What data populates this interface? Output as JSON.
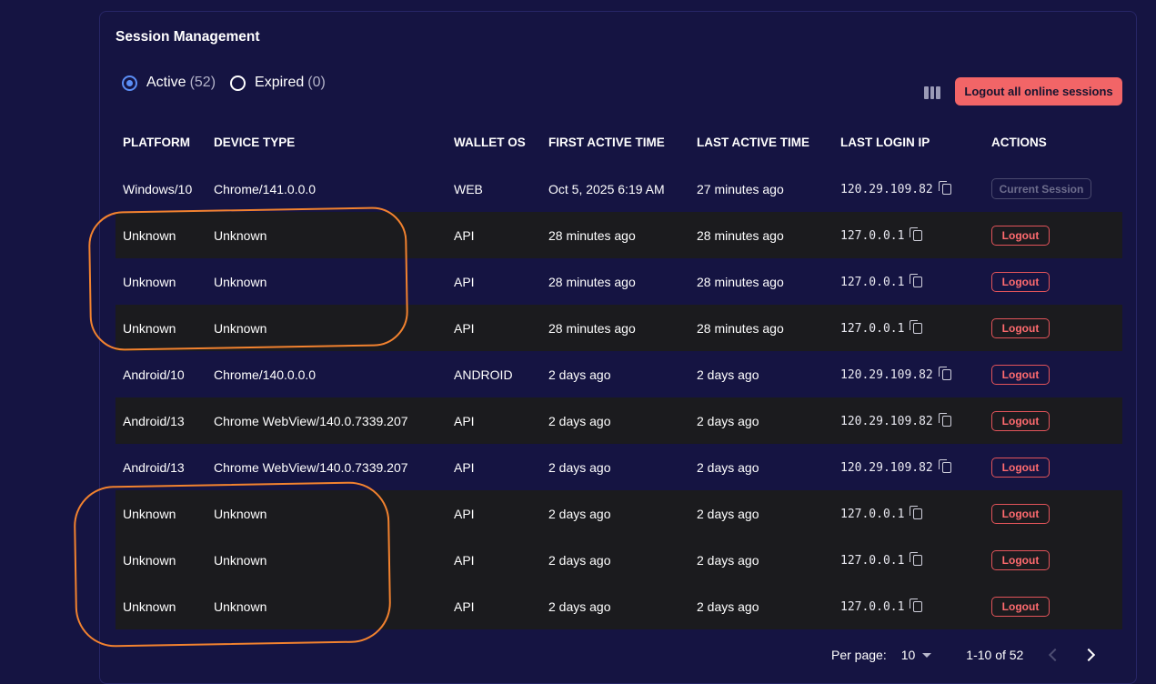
{
  "title": "Session Management",
  "filters": [
    {
      "label": "Active",
      "count": "(52)",
      "checked": true
    },
    {
      "label": "Expired",
      "count": "(0)",
      "checked": false
    }
  ],
  "toolbar": {
    "columns_icon": "columns-icon",
    "logout_all_label": "Logout all online sessions"
  },
  "table": {
    "headers": [
      "PLATFORM",
      "DEVICE TYPE",
      "WALLET OS",
      "FIRST ACTIVE TIME",
      "LAST ACTIVE TIME",
      "LAST LOGIN IP",
      "ACTIONS"
    ],
    "rows": [
      {
        "platform": "Windows/10",
        "device": "Chrome/141.0.0.0",
        "os": "WEB",
        "first": "Oct 5, 2025 6:19 AM",
        "last": "27 minutes ago",
        "ip": "120.29.109.82",
        "action": "Current Session"
      },
      {
        "platform": "Unknown",
        "device": "Unknown",
        "os": "API",
        "first": "28 minutes ago",
        "last": "28 minutes ago",
        "ip": "127.0.0.1",
        "action": "Logout"
      },
      {
        "platform": "Unknown",
        "device": "Unknown",
        "os": "API",
        "first": "28 minutes ago",
        "last": "28 minutes ago",
        "ip": "127.0.0.1",
        "action": "Logout"
      },
      {
        "platform": "Unknown",
        "device": "Unknown",
        "os": "API",
        "first": "28 minutes ago",
        "last": "28 minutes ago",
        "ip": "127.0.0.1",
        "action": "Logout"
      },
      {
        "platform": "Android/10",
        "device": "Chrome/140.0.0.0",
        "os": "ANDROID",
        "first": "2 days ago",
        "last": "2 days ago",
        "ip": "120.29.109.82",
        "action": "Logout"
      },
      {
        "platform": "Android/13",
        "device": "Chrome WebView/140.0.7339.207",
        "os": "API",
        "first": "2 days ago",
        "last": "2 days ago",
        "ip": "120.29.109.82",
        "action": "Logout"
      },
      {
        "platform": "Android/13",
        "device": "Chrome WebView/140.0.7339.207",
        "os": "API",
        "first": "2 days ago",
        "last": "2 days ago",
        "ip": "120.29.109.82",
        "action": "Logout"
      },
      {
        "platform": "Unknown",
        "device": "Unknown",
        "os": "API",
        "first": "2 days ago",
        "last": "2 days ago",
        "ip": "127.0.0.1",
        "action": "Logout"
      },
      {
        "platform": "Unknown",
        "device": "Unknown",
        "os": "API",
        "first": "2 days ago",
        "last": "2 days ago",
        "ip": "127.0.0.1",
        "action": "Logout"
      },
      {
        "platform": "Unknown",
        "device": "Unknown",
        "os": "API",
        "first": "2 days ago",
        "last": "2 days ago",
        "ip": "127.0.0.1",
        "action": "Logout"
      }
    ]
  },
  "pagination": {
    "per_page_label": "Per page:",
    "per_page_value": "10",
    "range": "1-10 of 52"
  },
  "colors": {
    "background": "#151442",
    "accent": "#f26567",
    "radio": "#5b8ef5",
    "annotation": "#f2822f"
  }
}
